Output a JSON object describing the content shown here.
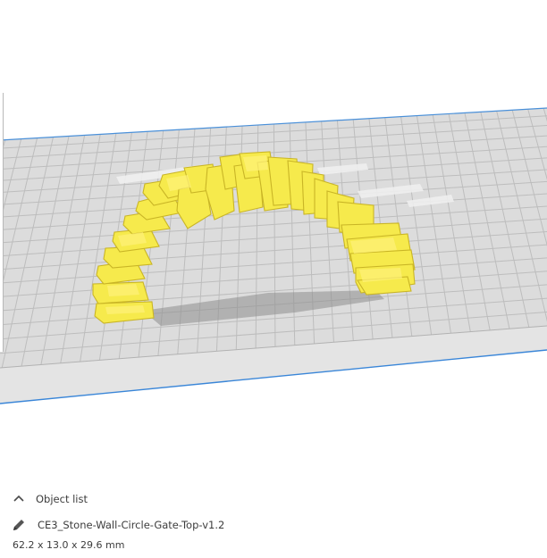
{
  "object_list": {
    "label": "Object list",
    "expand_icon": "chevron-up-icon"
  },
  "object": {
    "name": "CE3_Stone-Wall-Circle-Gate-Top-v1.2",
    "dimensions": "62.2 x 13.0 x 29.6 mm",
    "edit_icon": "pencil-icon"
  },
  "colors": {
    "model": "#f5e64b",
    "model_shadow": "#d8c428",
    "build_plate": "#dcdcdc",
    "grid": "#bcbcbc",
    "plate_edge_line": "#3a86d8"
  }
}
